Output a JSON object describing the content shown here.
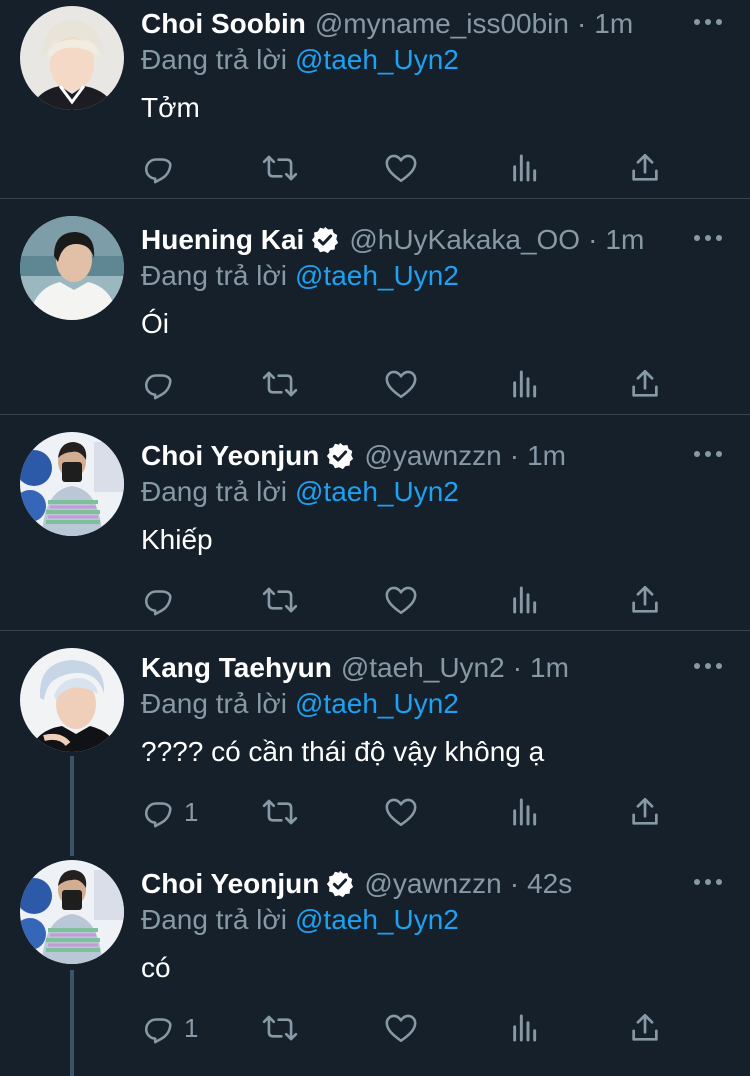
{
  "reply_prefix": "Đang trả lời",
  "tweets": [
    {
      "name": "Choi Soobin",
      "verified": false,
      "handle": "@myname_iss00bin",
      "dot": "·",
      "time": "1m",
      "reply_to": "@taeh_Uyn2",
      "text": "Tởm",
      "reply_count": ""
    },
    {
      "name": "Huening Kai",
      "verified": true,
      "handle": "@hUyKakaka_OO",
      "dot": "·",
      "time": "1m",
      "reply_to": "@taeh_Uyn2",
      "text": "Ói",
      "reply_count": ""
    },
    {
      "name": "Choi Yeonjun",
      "verified": true,
      "handle": "@yawnzzn",
      "dot": "·",
      "time": "1m",
      "reply_to": "@taeh_Uyn2",
      "text": "Khiếp",
      "reply_count": ""
    },
    {
      "name": "Kang Taehyun",
      "verified": false,
      "handle": "@taeh_Uyn2",
      "dot": "·",
      "time": "1m",
      "reply_to": "@taeh_Uyn2",
      "text": "???? có cần thái độ vậy không ạ",
      "reply_count": "1"
    },
    {
      "name": "Choi Yeonjun",
      "verified": true,
      "handle": "@yawnzzn",
      "dot": "·",
      "time": "42s",
      "reply_to": "@taeh_Uyn2",
      "text": "có",
      "reply_count": "1"
    }
  ],
  "icons": {
    "reply": "reply-icon",
    "retweet": "retweet-icon",
    "like": "heart-icon",
    "analytics": "analytics-icon",
    "share": "share-icon",
    "more": "more-icon",
    "verified": "verified-badge-icon"
  },
  "colors": {
    "background": "#15202b",
    "text": "#ffffff",
    "muted": "#8899a6",
    "mention": "#1da1f2",
    "divider": "#38444d",
    "thread_line": "#3d5466"
  }
}
